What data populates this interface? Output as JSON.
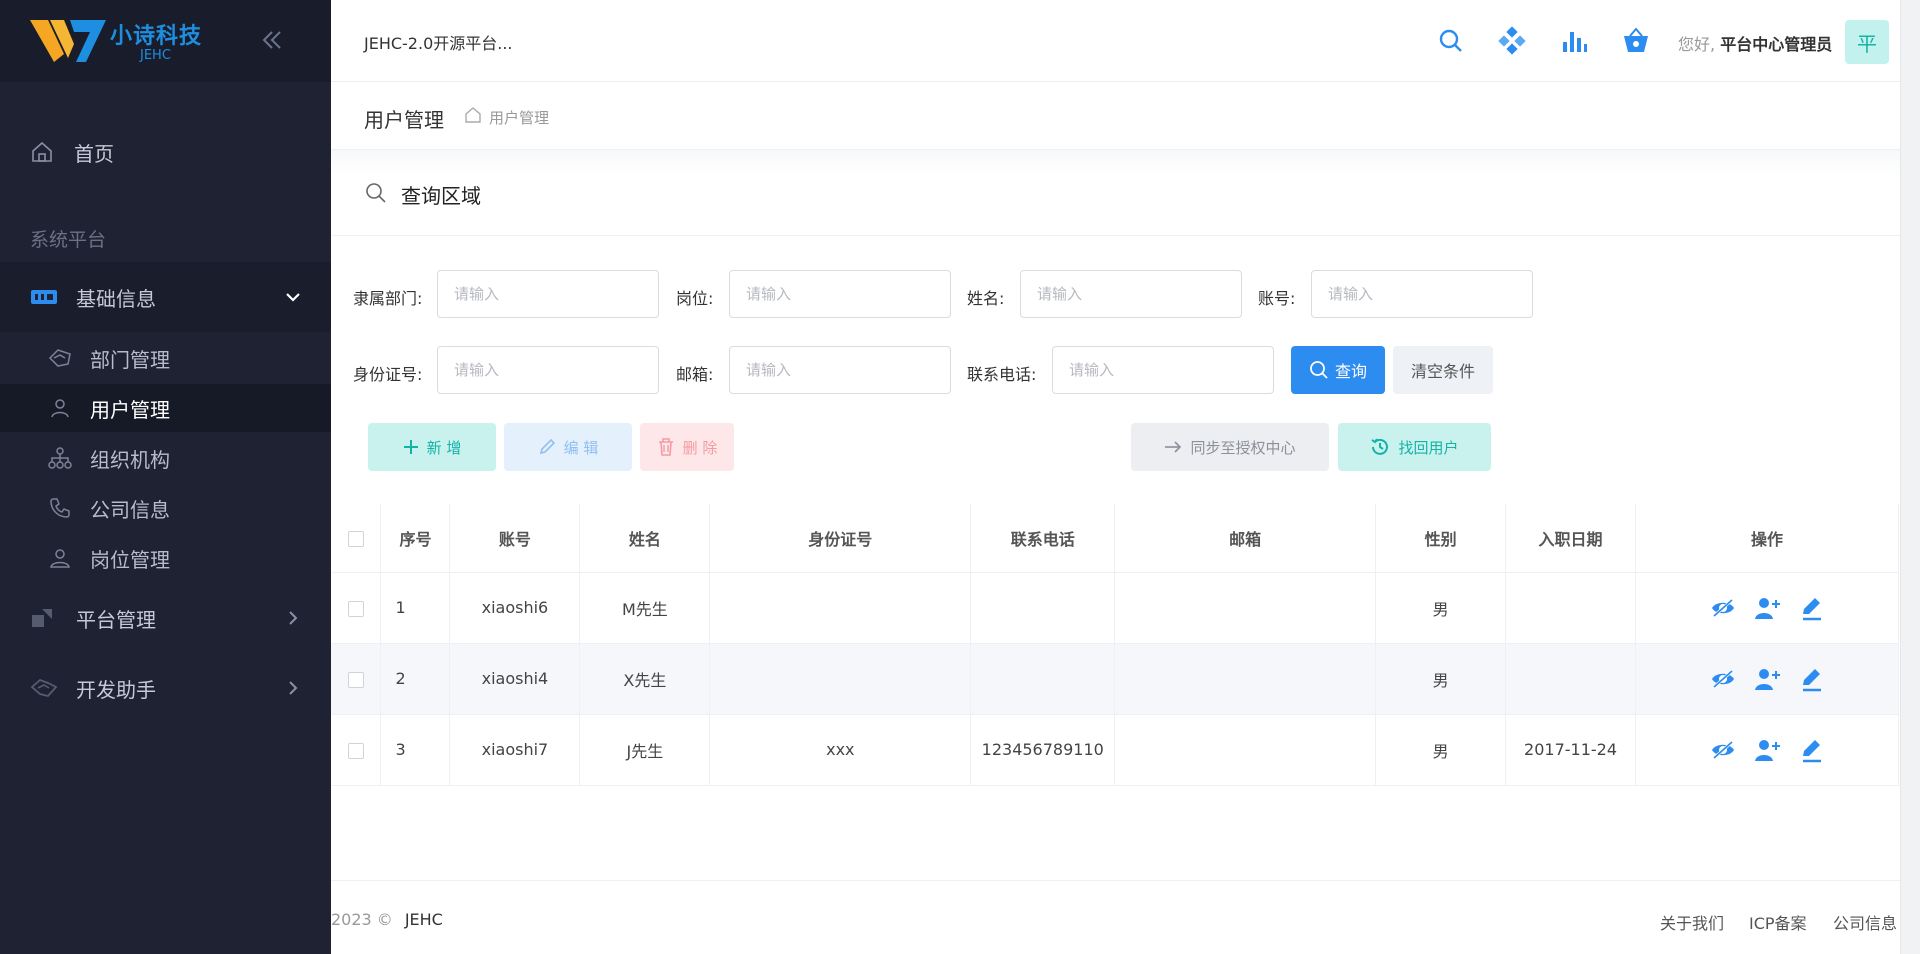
{
  "brand": {
    "name": "小诗科技",
    "sub": "JEHC"
  },
  "header": {
    "title": "JEHC-2.0开源平台...",
    "greeting_prefix": "您好,",
    "user_name": "平台中心管理员",
    "avatar_char": "平"
  },
  "sidebar": {
    "home": "首页",
    "section": "系统平台",
    "groups": [
      {
        "label": "基础信息",
        "expanded": true
      },
      {
        "label": "平台管理",
        "expanded": false
      },
      {
        "label": "开发助手",
        "expanded": false
      }
    ],
    "sub_items": [
      {
        "label": "部门管理",
        "icon": "department-icon"
      },
      {
        "label": "用户管理",
        "icon": "user-icon",
        "selected": true
      },
      {
        "label": "组织机构",
        "icon": "org-chart-icon"
      },
      {
        "label": "公司信息",
        "icon": "phone-icon"
      },
      {
        "label": "岗位管理",
        "icon": "position-icon"
      }
    ]
  },
  "breadcrumb": {
    "title": "用户管理",
    "current": "用户管理"
  },
  "search": {
    "title": "查询区域",
    "fields": {
      "department": {
        "label": "隶属部门:",
        "placeholder": "请输入"
      },
      "position": {
        "label": "岗位:",
        "placeholder": "请输入"
      },
      "name": {
        "label": "姓名:",
        "placeholder": "请输入"
      },
      "account": {
        "label": "账号:",
        "placeholder": "请输入"
      },
      "id_card": {
        "label": "身份证号:",
        "placeholder": "请输入"
      },
      "email": {
        "label": "邮箱:",
        "placeholder": "请输入"
      },
      "phone": {
        "label": "联系电话:",
        "placeholder": "请输入"
      }
    },
    "query_label": "查询",
    "clear_label": "清空条件"
  },
  "actions": {
    "add": "新 增",
    "edit": "编 辑",
    "delete": "删 除",
    "sync": "同步至授权中心",
    "restore": "找回用户"
  },
  "table": {
    "headers": [
      "序号",
      "账号",
      "姓名",
      "身份证号",
      "联系电话",
      "邮箱",
      "性别",
      "入职日期",
      "操作"
    ],
    "rows": [
      {
        "no": "1",
        "account": "xiaoshi6",
        "name": "M先生",
        "id_card": "",
        "phone": "",
        "email": "",
        "gender": "男",
        "date": ""
      },
      {
        "no": "2",
        "account": "xiaoshi4",
        "name": "X先生",
        "id_card": "",
        "phone": "",
        "email": "",
        "gender": "男",
        "date": ""
      },
      {
        "no": "3",
        "account": "xiaoshi7",
        "name": "J先生",
        "id_card": "xxx",
        "phone": "123456789110",
        "email": "",
        "gender": "男",
        "date": "2017-11-24"
      }
    ]
  },
  "footer": {
    "copyright": "2023 ©",
    "brand": "JEHC",
    "links": [
      "关于我们",
      "ICP备案",
      "公司信息"
    ]
  },
  "colors": {
    "sidebar_bg": "#1e2233",
    "primary": "#2d8cf0",
    "teal": "#14b3a6"
  }
}
